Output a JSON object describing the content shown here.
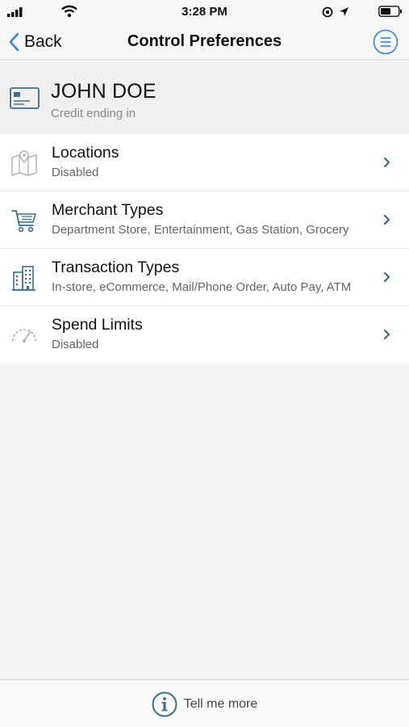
{
  "status_bar": {
    "time": "3:28 PM"
  },
  "nav": {
    "back_label": "Back",
    "title": "Control Preferences"
  },
  "card": {
    "name": "JOHN DOE",
    "subtitle": "Credit ending in"
  },
  "items": [
    {
      "title": "Locations",
      "subtitle": "Disabled",
      "icon": "map-icon"
    },
    {
      "title": "Merchant Types",
      "subtitle": "Department Store, Entertainment, Gas Station, Grocery",
      "icon": "cart-icon"
    },
    {
      "title": "Transaction Types",
      "subtitle": "In-store, eCommerce, Mail/Phone Order, Auto Pay, ATM",
      "icon": "building-icon"
    },
    {
      "title": "Spend Limits",
      "subtitle": "Disabled",
      "icon": "gauge-icon"
    }
  ],
  "footer": {
    "tell_more_label": "Tell me more"
  },
  "colors": {
    "accent": "#2f86d6",
    "icon_steel": "#3c6e8f",
    "chevron": "#2e5f86"
  }
}
